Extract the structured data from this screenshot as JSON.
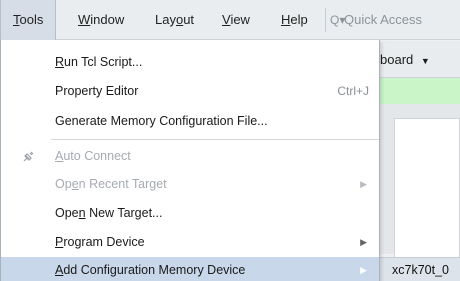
{
  "menubar": {
    "items": [
      {
        "mnemonic": "T",
        "rest": "ools"
      },
      {
        "mnemonic": "W",
        "rest": "indow"
      },
      {
        "pre": "Lay",
        "mnemonic": "o",
        "rest": "ut"
      },
      {
        "mnemonic": "V",
        "rest": "iew"
      },
      {
        "mnemonic": "H",
        "rest": "elp"
      }
    ],
    "quick_access_placeholder": "Quick Access"
  },
  "background": {
    "toolbar_label": "board",
    "bottom_label": "xc7k70t_0"
  },
  "tools_menu": {
    "items": [
      {
        "pre": "",
        "mnemonic": "R",
        "rest": "un Tcl Script...",
        "shortcut": "",
        "enabled": true
      },
      {
        "pre": "Property Editor",
        "mnemonic": "",
        "rest": "",
        "shortcut": "Ctrl+J",
        "enabled": true
      },
      {
        "pre": "Generate Memory Confi",
        "mnemonic": "g",
        "rest": "uration File...",
        "shortcut": "",
        "enabled": true
      },
      {
        "pre": "",
        "mnemonic": "A",
        "rest": "uto Connect",
        "shortcut": "",
        "enabled": false
      },
      {
        "pre": "Op",
        "mnemonic": "e",
        "rest": "n Recent Target",
        "shortcut": "",
        "enabled": false
      },
      {
        "pre": "Ope",
        "mnemonic": "n",
        "rest": " New Target...",
        "shortcut": "",
        "enabled": true
      },
      {
        "pre": "",
        "mnemonic": "P",
        "rest": "rogram Device",
        "shortcut": "",
        "enabled": true
      },
      {
        "pre": "",
        "mnemonic": "A",
        "rest": "dd Configuration Memory Device",
        "shortcut": "",
        "enabled": true
      }
    ],
    "auto_connect_icon": "plug-icon",
    "highlight_color": "#c8d7ea"
  }
}
